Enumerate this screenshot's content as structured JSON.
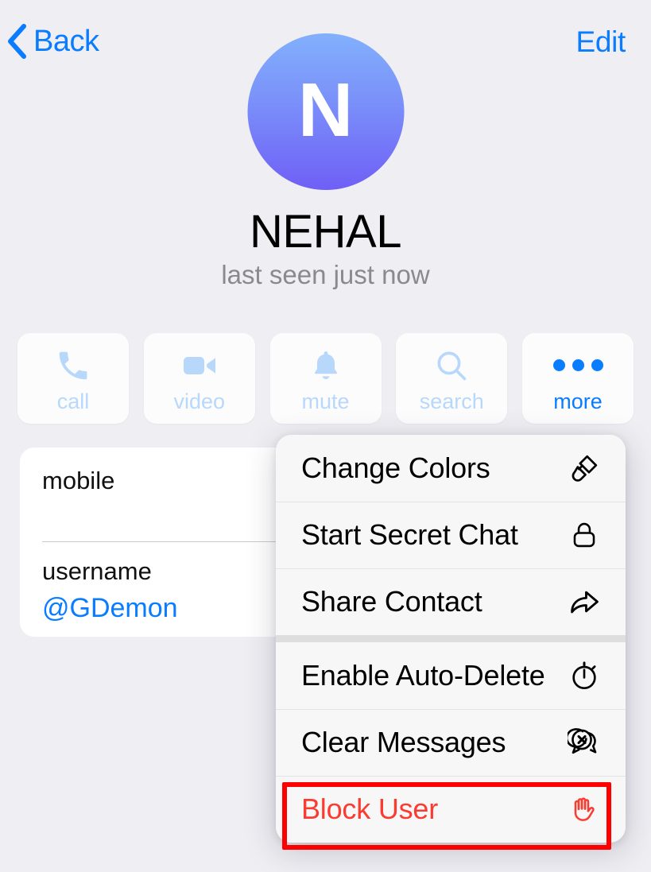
{
  "nav": {
    "back_label": "Back",
    "back_icon": "chevron-left-icon",
    "edit_label": "Edit"
  },
  "profile": {
    "avatar_letter": "N",
    "avatar_gradient_from": "#82b0fc",
    "avatar_gradient_to": "#6f5ff6",
    "name": "NEHAL",
    "status": "last seen just now"
  },
  "actions": [
    {
      "label": "call",
      "icon": "phone-icon",
      "active": false
    },
    {
      "label": "video",
      "icon": "video-camera-icon",
      "active": false
    },
    {
      "label": "mute",
      "icon": "bell-icon",
      "active": false
    },
    {
      "label": "search",
      "icon": "magnifier-icon",
      "active": false
    },
    {
      "label": "more",
      "icon": "ellipsis-icon",
      "active": true
    }
  ],
  "info_card": {
    "rows": [
      {
        "label": "mobile",
        "value": ""
      },
      {
        "label": "username",
        "value": "@GDemon"
      }
    ]
  },
  "context_menu": {
    "groups": [
      {
        "items": [
          {
            "label": "Change Colors",
            "icon": "paintbrush-icon",
            "destructive": false
          },
          {
            "label": "Start Secret Chat",
            "icon": "lock-icon",
            "destructive": false
          },
          {
            "label": "Share Contact",
            "icon": "share-arrow-icon",
            "destructive": false
          }
        ]
      },
      {
        "items": [
          {
            "label": "Enable Auto-Delete",
            "icon": "timer-icon",
            "destructive": false
          },
          {
            "label": "Clear Messages",
            "icon": "chat-delete-icon",
            "destructive": false
          },
          {
            "label": "Block User",
            "icon": "stop-hand-icon",
            "destructive": true
          }
        ]
      }
    ]
  },
  "annotation": {
    "target": "Block User",
    "color": "#ff0000"
  },
  "theme": {
    "background": "#EFEEF3",
    "accent_blue": "#0a7cff",
    "muted_blue": "#b8d8fb",
    "destructive_red": "#fb3b30",
    "menu_surface": "#f7f7f8"
  }
}
